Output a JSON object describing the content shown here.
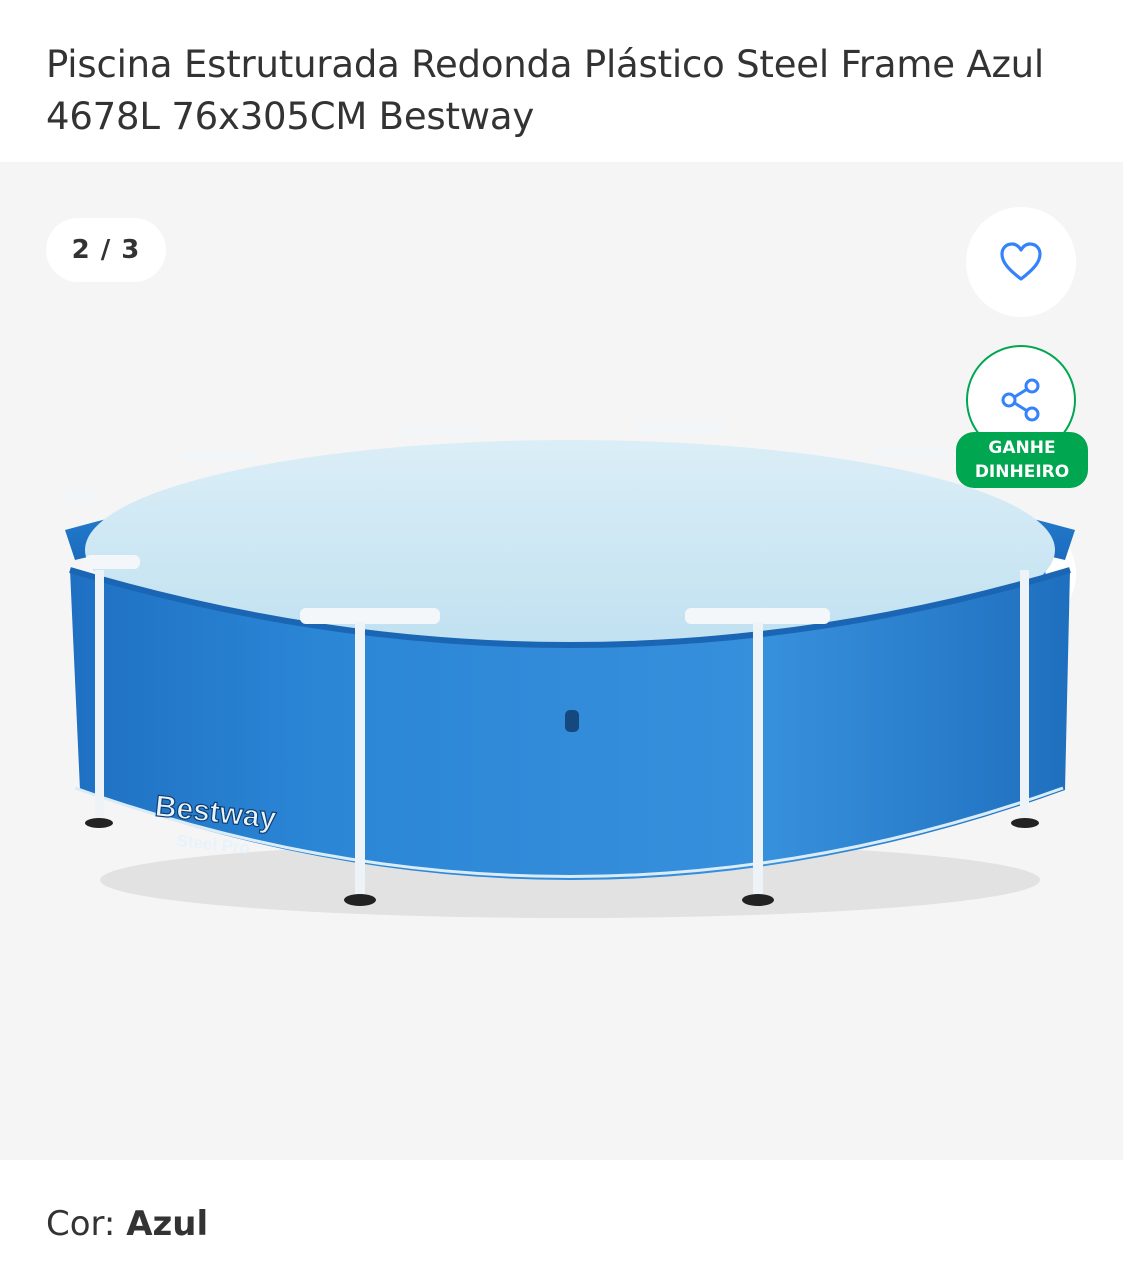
{
  "product": {
    "title": "Piscina Estruturada Redonda Plástico Steel Frame Azul 4678L 76x305CM Bestway",
    "color_label": "Cor: ",
    "color_value": "Azul"
  },
  "gallery": {
    "counter": "2 / 3",
    "current_image": 2,
    "total_images": 3,
    "image_brand_text": "Bestway",
    "image_model_text": "Steel Pro",
    "favorite_icon": "heart-icon",
    "share_icon": "share-icon",
    "whatsapp_icon": "whatsapp-icon"
  },
  "share": {
    "badge_text": "GANHE\nDINHEIRO"
  },
  "colors": {
    "accent_green": "#00a650",
    "accent_blue": "#3483fa",
    "pool_blue": "#2b86d6",
    "background_gray": "#f5f5f5"
  }
}
